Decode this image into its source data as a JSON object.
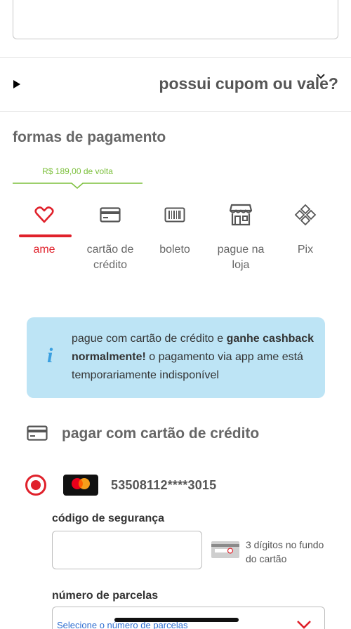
{
  "coupon": {
    "label": "possui cupom ou vale?"
  },
  "payment": {
    "section_title": "formas de pagamento",
    "cashback_tip": "R$ 189,00 de volta",
    "tabs": [
      {
        "label": "ame",
        "icon": "ame-heart-icon",
        "active": true
      },
      {
        "label": "cartão de crédito",
        "icon": "credit-card-icon",
        "active": false
      },
      {
        "label": "boleto",
        "icon": "barcode-icon",
        "active": false
      },
      {
        "label": "pague na loja",
        "icon": "store-icon",
        "active": false
      },
      {
        "label": "Pix",
        "icon": "pix-icon",
        "active": false
      }
    ],
    "info": {
      "part1": "pague com cartão de crédito e ",
      "bold": "ganhe cashback normalmente!",
      "part2": " o pagamento via app ame está temporariamente indisponível"
    }
  },
  "credit_card": {
    "header": "pagar com cartão de crédito",
    "saved_card": {
      "brand": "mastercard",
      "number": "53508112****3015",
      "selected": true
    },
    "cvv_label": "código de segurança",
    "cvv_hint": "3 dígitos no fundo do cartão",
    "installments_label": "número de parcelas",
    "installments_placeholder": "Selecione o número de parcelas"
  },
  "colors": {
    "accent": "#e0212b",
    "info_bg": "#bde4f5",
    "cashback_green": "#7bbf3a"
  }
}
